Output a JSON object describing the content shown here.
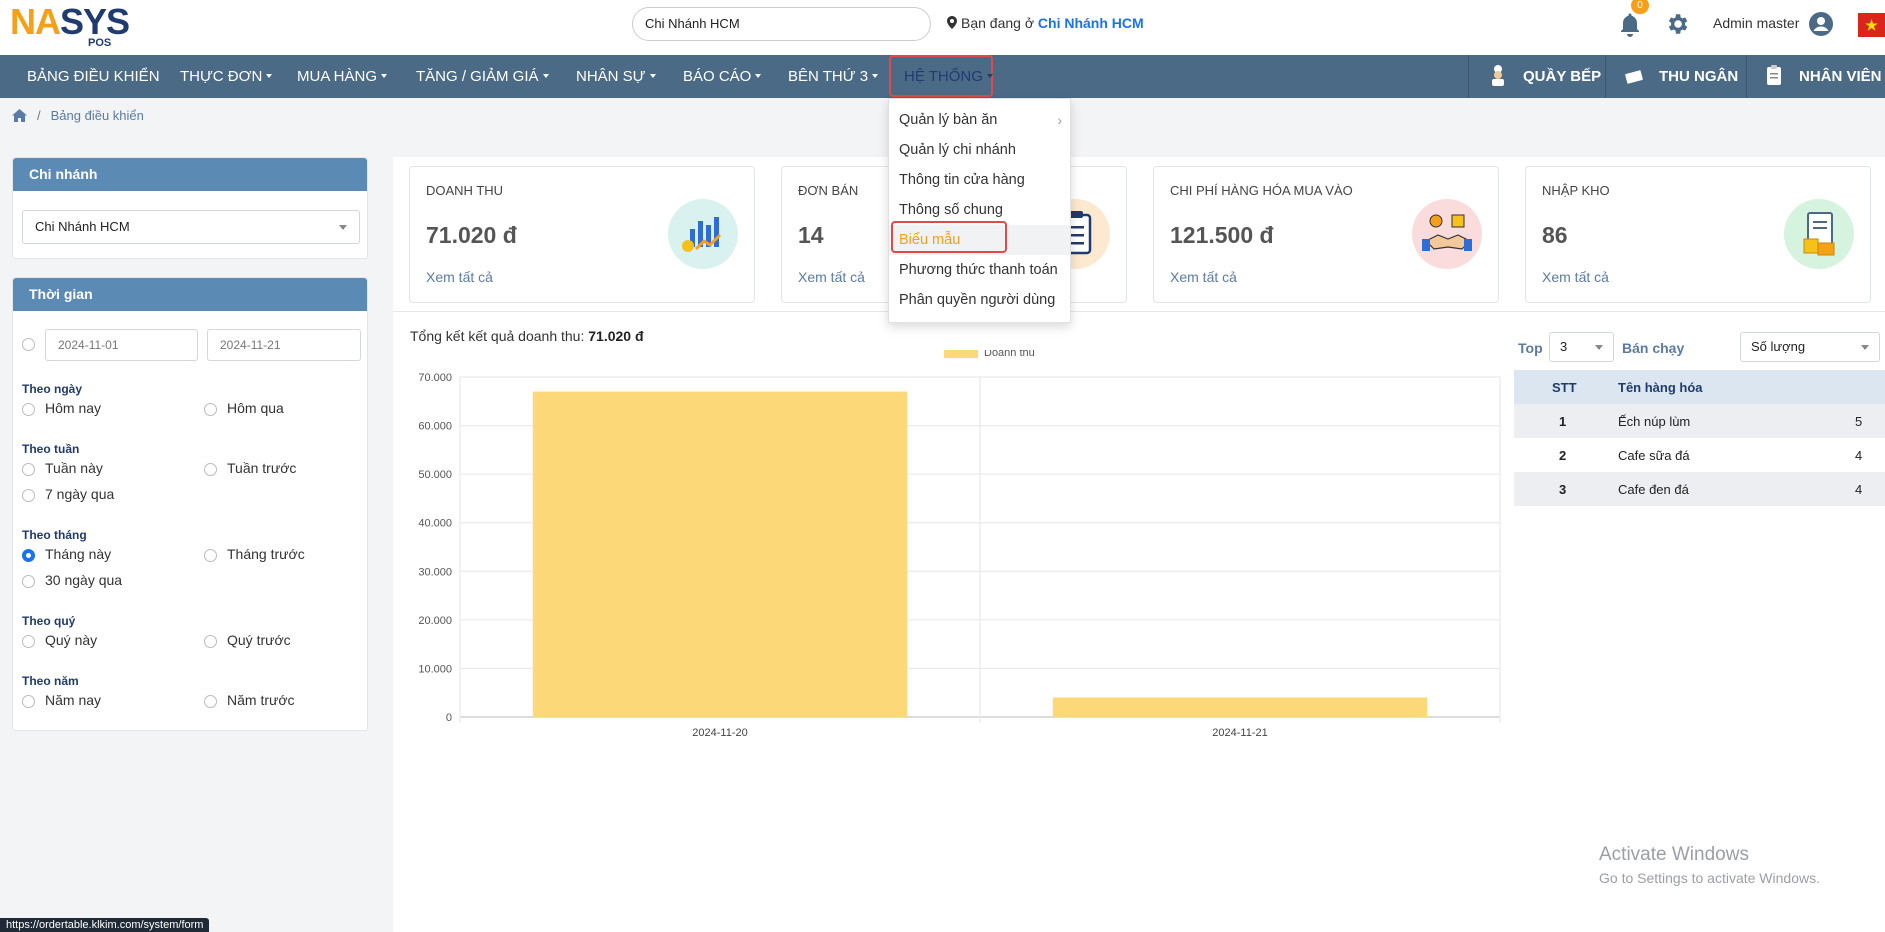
{
  "header": {
    "logo": {
      "na": "NA",
      "sys": "SYS",
      "pos": "POS"
    },
    "branch_search_value": "Chi Nhánh HCM",
    "location_prefix": "Bạn đang ở",
    "location_branch": "Chi Nhánh HCM",
    "notification_count": "0",
    "user_name": "Admin master"
  },
  "nav": {
    "items": [
      "BẢNG ĐIỀU KHIỂN",
      "THỰC ĐƠN",
      "MUA HÀNG",
      "TĂNG / GIẢM GIÁ",
      "NHÂN SỰ",
      "BÁO CÁO",
      "BÊN THỨ 3",
      "HỆ THỐNG"
    ],
    "right": [
      "QUẦY BẾP",
      "THU NGÂN",
      "NHÂN VIÊN"
    ]
  },
  "dropdown": {
    "items": [
      "Quản lý bàn ăn",
      "Quản lý chi nhánh",
      "Thông tin cửa hàng",
      "Thông số chung",
      "Biểu mẫu",
      "Phương thức thanh toán",
      "Phân quyền người dùng"
    ],
    "highlighted": "Biểu mẫu"
  },
  "breadcrumb": {
    "current": "Bảng điều khiển"
  },
  "branch_panel": {
    "title": "Chi nhánh",
    "selected": "Chi Nhánh HCM"
  },
  "time_panel": {
    "title": "Thời gian",
    "date_from": "2024-11-01",
    "date_to": "2024-11-21",
    "groups": [
      {
        "title": "Theo ngày",
        "options": [
          "Hôm nay",
          "Hôm qua"
        ]
      },
      {
        "title": "Theo tuần",
        "options": [
          "Tuần này",
          "Tuần trước",
          "7 ngày qua"
        ]
      },
      {
        "title": "Theo tháng",
        "options": [
          "Tháng này",
          "Tháng trước",
          "30 ngày qua"
        ]
      },
      {
        "title": "Theo quý",
        "options": [
          "Quý này",
          "Quý trước"
        ]
      },
      {
        "title": "Theo năm",
        "options": [
          "Năm nay",
          "Năm trước"
        ]
      }
    ],
    "selected": "Tháng này"
  },
  "cards": [
    {
      "title": "DOANH THU",
      "value": "71.020 đ",
      "link": "Xem tất cả",
      "icon": "chart-growth-icon",
      "icon_bg": "#d9f2ef"
    },
    {
      "title": "ĐƠN BÁN",
      "value": "14",
      "link": "Xem tất cả",
      "icon": "clipboard-list-icon",
      "icon_bg": "#fde9cf"
    },
    {
      "title": "CHI PHÍ HÀNG HÓA MUA VÀO",
      "value": "121.500 đ",
      "link": "Xem tất cả",
      "icon": "handshake-icon",
      "icon_bg": "#fbdcdc"
    },
    {
      "title": "NHẬP KHO",
      "value": "86",
      "link": "Xem tất cả",
      "icon": "inventory-icon",
      "icon_bg": "#d6f3df"
    }
  ],
  "summary": {
    "label": "Tổng kết kết quả doanh thu:",
    "value": "71.020 đ"
  },
  "chart_data": {
    "type": "bar",
    "categories": [
      "2024-11-20",
      "2024-11-21"
    ],
    "series": [
      {
        "name": "Doanh thu",
        "values": [
          67000,
          4020
        ]
      }
    ],
    "yticks": [
      "0",
      "10.000",
      "20.000",
      "30.000",
      "40.000",
      "50.000",
      "60.000",
      "70.000"
    ],
    "ylim": [
      0,
      70000
    ],
    "bar_color": "#fdd878",
    "grid": true,
    "legend": "top-center"
  },
  "top_sellers": {
    "top_label": "Top",
    "top_value": "3",
    "ban_chay_label": "Bán chạy",
    "metric": "Số lượng",
    "columns": [
      "STT",
      "Tên hàng hóa"
    ],
    "rows": [
      {
        "stt": "1",
        "name": "Ếch núp lùm",
        "qty": "5"
      },
      {
        "stt": "2",
        "name": "Cafe sữa đá",
        "qty": "4"
      },
      {
        "stt": "3",
        "name": "Cafe đen đá",
        "qty": "4"
      }
    ]
  },
  "watermark": {
    "line1": "Activate Windows",
    "line2": "Go to Settings to activate Windows."
  },
  "status_url": "https://ordertable.klkim.com/system/form"
}
